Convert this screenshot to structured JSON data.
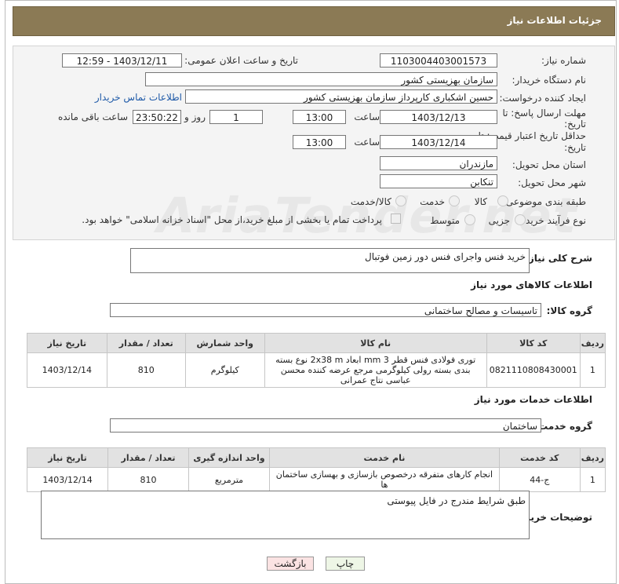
{
  "header": {
    "title": "جزئیات اطلاعات نیاز"
  },
  "watermark": "AriaTender.net",
  "form": {
    "need_number_label": "شماره نیاز:",
    "need_number": "1103004403001573",
    "announce_label": "تاریخ و ساعت اعلان عمومی:",
    "announce_value": "1403/12/11 - 12:59",
    "buyer_org_label": "نام دستگاه خریدار:",
    "buyer_org": "سازمان بهزیستی کشور",
    "creator_label": "ایجاد کننده درخواست:",
    "creator": "حسین اشکباری کارپرداز سازمان بهزیستی کشور",
    "contact_link": "اطلاعات تماس خریدار",
    "deadline_label_1": "مهلت ارسال پاسخ: تا",
    "deadline_label_2": "تاریخ:",
    "deadline_date": "1403/12/13",
    "time_label": "ساعت",
    "deadline_time": "13:00",
    "days_value": "1",
    "days_label": "روز و",
    "remaining_time": "23:50:22",
    "remaining_label": "ساعت باقی مانده",
    "validity_label_1": "حداقل تاریخ اعتبار قیمت: تا",
    "validity_label_2": "تاریخ:",
    "validity_date": "1403/12/14",
    "validity_time_label": "ساعت",
    "validity_time": "13:00",
    "province_label": "استان محل تحویل:",
    "province": "مازندران",
    "city_label": "شهر محل تحویل:",
    "city": "تنکابن",
    "category_label": "طبقه بندی موضوعی:",
    "category_options": [
      "کالا",
      "خدمت",
      "کالا/خدمت"
    ],
    "process_label": "نوع فرآیند خرید :",
    "process_options": [
      "جزیی",
      "متوسط"
    ],
    "payment_note": "پرداخت تمام یا بخشی از مبلغ خرید،از محل \"اسناد خزانه اسلامی\" خواهد بود."
  },
  "summary": {
    "label": "شرح کلی نیاز:",
    "value": "خرید فنس واجرای فنس دور زمین فوتبال"
  },
  "goods": {
    "section_title": "اطلاعات کالاهای مورد نیاز",
    "group_label": "گروه کالا:",
    "group_value": "تاسیسات و مصالح ساختمانی",
    "headers": [
      "ردیف",
      "کد کالا",
      "نام کالا",
      "واحد شمارش",
      "تعداد / مقدار",
      "تاریخ نیاز"
    ],
    "rows": [
      {
        "row": "1",
        "code": "0821110808430001",
        "name": "توری فولادی فنس قطر 3 mm ابعاد 2x38 m نوع بسته بندی بسته رولی کیلوگرمی مرجع عرضه کننده محسن عباسی نتاج عمرانی",
        "unit": "کیلوگرم",
        "qty": "810",
        "date": "1403/12/14"
      }
    ]
  },
  "services": {
    "section_title": "اطلاعات خدمات مورد نیاز",
    "group_label": "گروه خدمت:",
    "group_value": "ساختمان",
    "headers": [
      "ردیف",
      "کد خدمت",
      "نام خدمت",
      "واحد اندازه گیری",
      "تعداد / مقدار",
      "تاریخ نیاز"
    ],
    "rows": [
      {
        "row": "1",
        "code": "ج-44",
        "name": "انجام کارهای متفرقه درخصوص بازسازی و بهسازی ساختمان ها",
        "unit": "مترمربع",
        "qty": "810",
        "date": "1403/12/14"
      }
    ]
  },
  "buyer_notes": {
    "label": "توضیحات خریدار:",
    "value": "طبق شرایط مندرج در فایل پیوستی"
  },
  "buttons": {
    "print": "چاپ",
    "back": "بازگشت"
  },
  "colors": {
    "header_bg": "#8b7a55",
    "link": "#1f5aa8",
    "back_button_bg": "#fbe3e3",
    "print_button_bg": "#eef6e6"
  }
}
